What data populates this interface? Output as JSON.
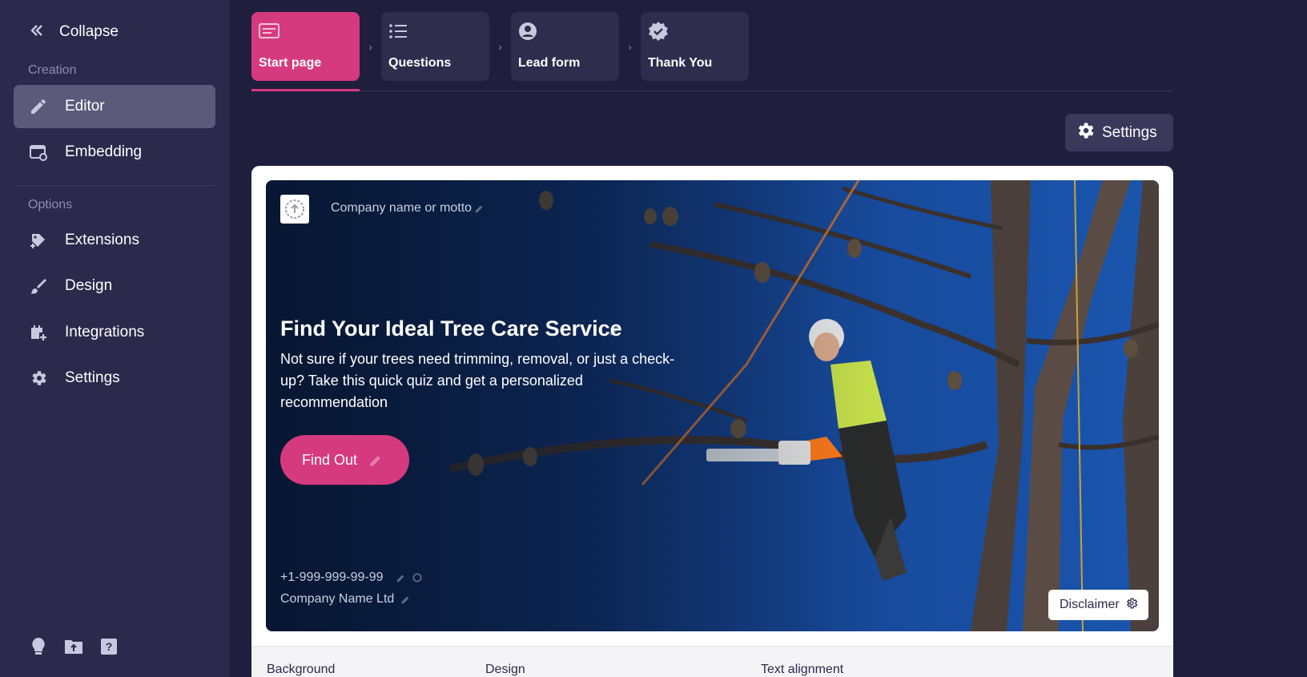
{
  "sidebar": {
    "collapse_label": "Collapse",
    "creation_label": "Creation",
    "options_label": "Options",
    "items": [
      {
        "label": "Editor",
        "icon": "pencil-icon",
        "active": true
      },
      {
        "label": "Embedding",
        "icon": "embed-icon"
      },
      {
        "label": "Extensions",
        "icon": "puzzle-icon"
      },
      {
        "label": "Design",
        "icon": "brush-icon"
      },
      {
        "label": "Integrations",
        "icon": "calendar-plus-icon"
      },
      {
        "label": "Settings",
        "icon": "gear-icon"
      }
    ],
    "bottom_icons": [
      "lightbulb-icon",
      "folder-upload-icon",
      "help-icon"
    ]
  },
  "steps": [
    {
      "label": "Start page",
      "icon": "page-icon",
      "active": true
    },
    {
      "label": "Questions",
      "icon": "list-icon"
    },
    {
      "label": "Lead form",
      "icon": "user-circle-icon"
    },
    {
      "label": "Thank You",
      "icon": "verified-icon"
    }
  ],
  "toolbar": {
    "settings_label": "Settings"
  },
  "hero": {
    "motto": "Company name or motto",
    "title": "Find Your Ideal Tree Care Service",
    "description": "Not sure if your trees need trimming, removal, or just a check-up? Take this quick quiz and get a personalized recommendation",
    "cta_label": "Find Out",
    "phone": "+1-999-999-99-99",
    "company": "Company Name Ltd",
    "disclaimer_label": "Disclaimer"
  },
  "bottom_panel": {
    "background_label": "Background",
    "design_label": "Design",
    "text_alignment_label": "Text alignment"
  },
  "colors": {
    "accent": "#d63a7e",
    "sidebar_bg": "#2b2a4c",
    "page_bg": "#1f1e3d"
  }
}
